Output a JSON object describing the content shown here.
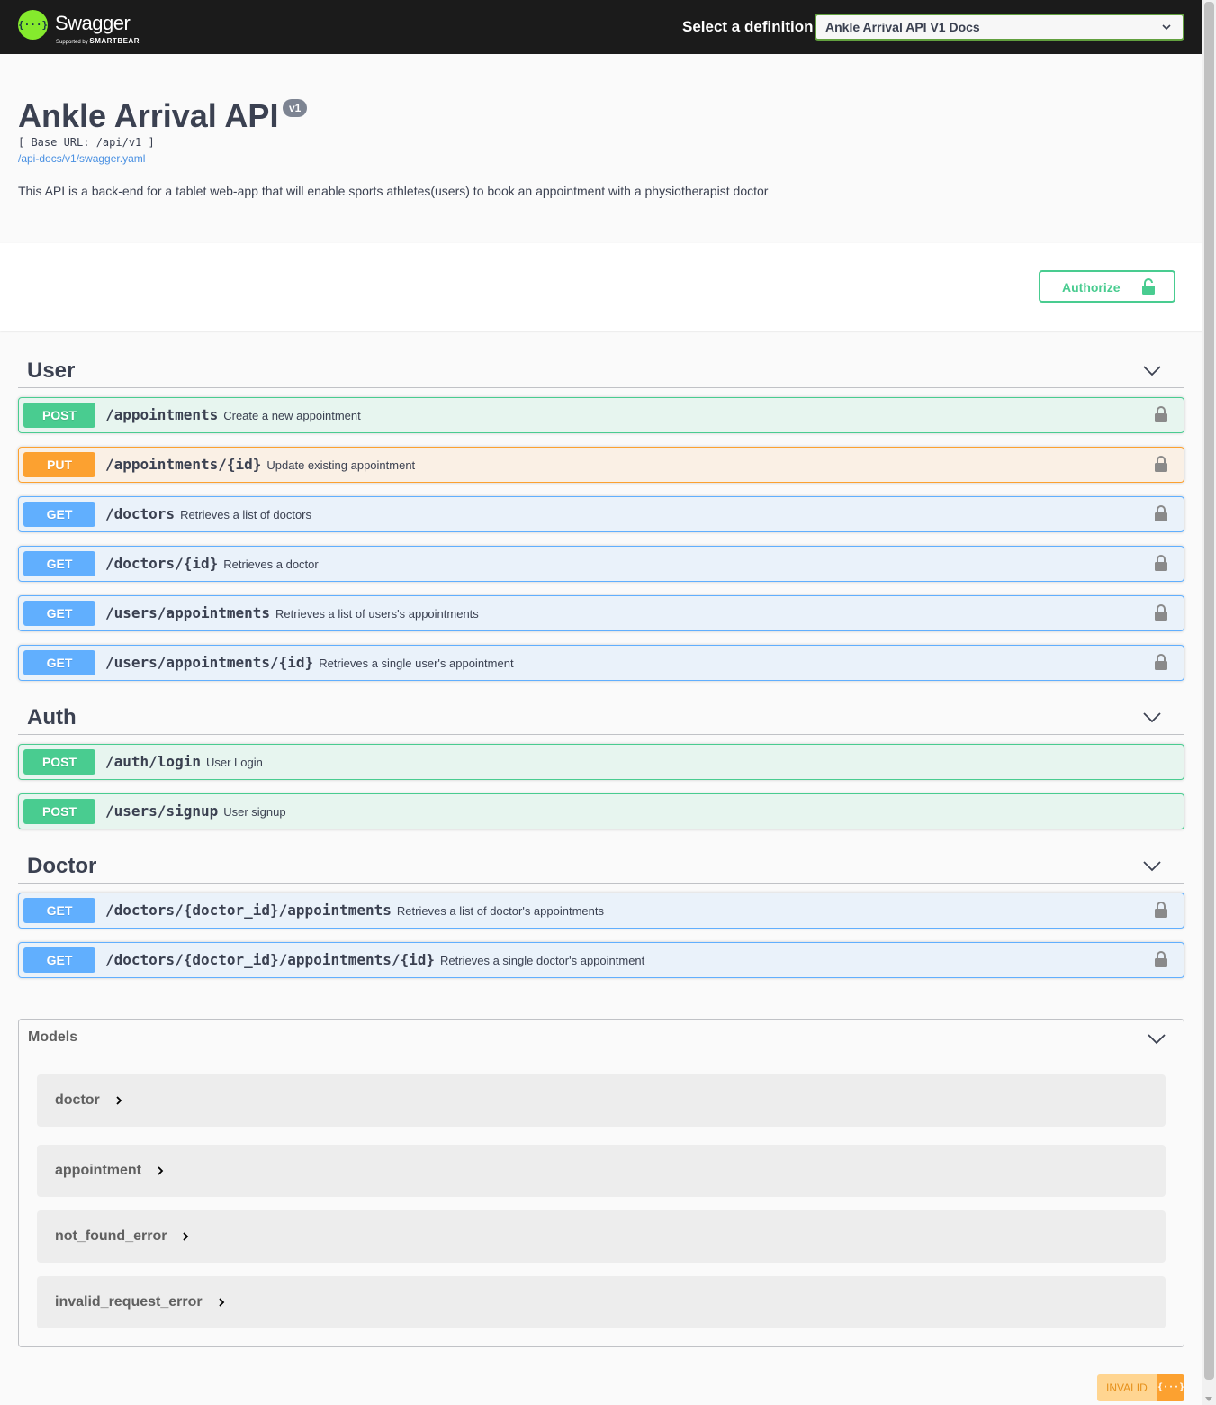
{
  "topbar": {
    "logo_glyph": "{···}",
    "logo_name": "Swagger",
    "logo_sub_prefix": "Supported by",
    "logo_sub_brand": "SMARTBEAR",
    "definition_label": "Select a definition",
    "definition_selected": "Ankle Arrival API V1 Docs"
  },
  "info": {
    "title": "Ankle Arrival API",
    "version": "v1",
    "base_url": "[ Base URL: /api/v1 ]",
    "spec_link": "/api-docs/v1/swagger.yaml",
    "description": "This API is a back-end for a tablet web-app that will enable sports athletes(users) to book an appointment with a physiotherapist doctor"
  },
  "authorize": {
    "label": "Authorize",
    "icon": "lock-open-icon"
  },
  "colors": {
    "post": "#49cc90",
    "put": "#fca130",
    "get": "#61affe"
  },
  "sections": [
    {
      "name": "User",
      "operations": [
        {
          "method": "POST",
          "path": "/appointments",
          "summary": "Create a new appointment"
        },
        {
          "method": "PUT",
          "path": "/appointments/{id}",
          "summary": "Update existing appointment"
        },
        {
          "method": "GET",
          "path": "/doctors",
          "summary": "Retrieves a list of doctors"
        },
        {
          "method": "GET",
          "path": "/doctors/{id}",
          "summary": "Retrieves a doctor"
        },
        {
          "method": "GET",
          "path": "/users/appointments",
          "summary": "Retrieves a list of users's appointments"
        },
        {
          "method": "GET",
          "path": "/users/appointments/{id}",
          "summary": "Retrieves a single user's appointment"
        }
      ]
    },
    {
      "name": "Auth",
      "operations": [
        {
          "method": "POST",
          "path": "/auth/login",
          "summary": "User Login"
        },
        {
          "method": "POST",
          "path": "/users/signup",
          "summary": "User signup"
        }
      ]
    },
    {
      "name": "Doctor",
      "operations": [
        {
          "method": "GET",
          "path": "/doctors/{doctor_id}/appointments",
          "summary": "Retrieves a list of doctor's appointments"
        },
        {
          "method": "GET",
          "path": "/doctors/{doctor_id}/appointments/{id}",
          "summary": "Retrieves a single doctor's appointment"
        }
      ]
    }
  ],
  "models": {
    "title": "Models",
    "items": [
      "doctor",
      "appointment",
      "not_found_error",
      "invalid_request_error"
    ]
  },
  "validator": {
    "label": "INVALID",
    "badge": "{···}"
  }
}
